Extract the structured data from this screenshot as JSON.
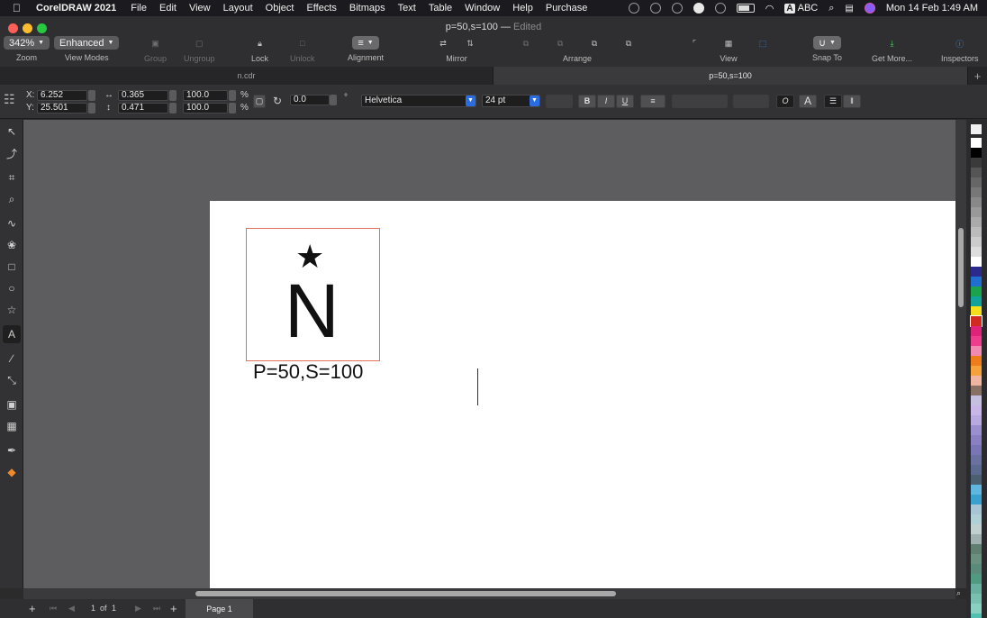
{
  "menubar": {
    "app_name": "CorelDRAW 2021",
    "items": [
      "File",
      "Edit",
      "View",
      "Layout",
      "Object",
      "Effects",
      "Bitmaps",
      "Text",
      "Table",
      "Window",
      "Help",
      "Purchase"
    ],
    "input_source": "ABC",
    "datetime": "Mon 14 Feb  1:49 AM"
  },
  "window": {
    "title": "p=50,s=100",
    "status": "Edited",
    "traffic_colors": [
      "#ff5f57",
      "#febc2e",
      "#28c840"
    ]
  },
  "toolbar": {
    "zoom_value": "342%",
    "zoom_label": "Zoom",
    "view_mode_value": "Enhanced",
    "view_mode_label": "View Modes",
    "group_label": "Group",
    "ungroup_label": "Ungroup",
    "lock_label": "Lock",
    "unlock_label": "Unlock",
    "alignment_label": "Alignment",
    "mirror_label": "Mirror",
    "arrange_label": "Arrange",
    "view_label": "View",
    "snap_label": "Snap To",
    "getmore_label": "Get More...",
    "inspectors_label": "Inspectors"
  },
  "tabs": [
    {
      "label": "n.cdr",
      "active": false
    },
    {
      "label": "p=50,s=100",
      "active": true
    }
  ],
  "propbar": {
    "x_label": "X:",
    "x_value": "6.252",
    "y_label": "Y:",
    "y_value": "25.501",
    "width_value": "0.365",
    "height_value": "0.471",
    "scale_w": "100.0",
    "scale_h": "100.0",
    "percent": "%",
    "rotation": "0.0",
    "degree": "°",
    "font_name": "Helvetica",
    "font_size": "24 pt",
    "bold": "B",
    "italic": "I",
    "underline": "U"
  },
  "canvas": {
    "star_glyph": "★",
    "letter": "N",
    "caption": "P=50,S=100"
  },
  "statusbar": {
    "page_current": "1",
    "page_of": "of",
    "page_total": "1",
    "page_tab": "Page 1"
  },
  "palette": [
    "#ffffff",
    "#000000",
    "#3a3a3a",
    "#555555",
    "#666666",
    "#777777",
    "#888888",
    "#999999",
    "#aaaaaa",
    "#bbbbbb",
    "#cccccc",
    "#dddddd",
    "#ffffff",
    "#2c2a8c",
    "#1f6fd1",
    "#1aa34a",
    "#0fa39b",
    "#f4e01a",
    "#d12a1f",
    "#e0237a",
    "#ee3d8c",
    "#f08ab0",
    "#ef7c1a",
    "#f5a23a",
    "#f0b5a0",
    "#8a6f63",
    "#c5c0e0",
    "#c8b6e8",
    "#b8a9e0",
    "#9c8fd0",
    "#8a7fc0",
    "#7a75b5",
    "#6a70a0",
    "#5a6a90",
    "#4a6070",
    "#5fb6e0",
    "#3aa0d0",
    "#a6c6d6",
    "#b0d0d8",
    "#c0d0d0",
    "#9fb0b0",
    "#5f8070",
    "#6a9080",
    "#5a8a7a",
    "#4f9a80",
    "#6ab0a0",
    "#7ac0b0",
    "#8ad0c0",
    "#4fc0b0"
  ]
}
